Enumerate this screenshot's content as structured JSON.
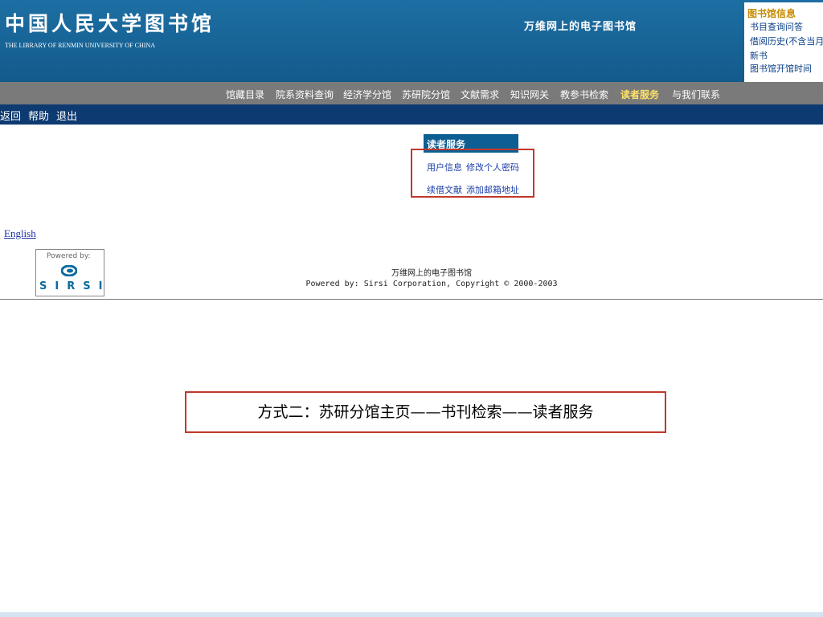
{
  "header": {
    "logo_cn": "中国人民大学图书馆",
    "logo_en": "THE LIBRARY OF RENMIN UNIVERSITY OF CHINA",
    "site_title": "万维网上的电子图书馆"
  },
  "info_box": {
    "title": "图书馆信息",
    "links": [
      "书目查询问答",
      "借阅历史(不含当月)",
      "新书",
      "图书馆开馆时间"
    ]
  },
  "nav": {
    "items": [
      "馆藏目录",
      "院系资料查询",
      "经济学分馆",
      "苏研院分馆",
      "文献需求",
      "知识网关",
      "教参书检索",
      "读者服务",
      "与我们联系"
    ],
    "active": "读者服务"
  },
  "subnav": {
    "items": [
      "返回",
      "帮助",
      "退出"
    ]
  },
  "reader_service": {
    "title": "读者服务",
    "links": [
      "用户信息",
      "修改个人密码",
      "续借文献",
      "添加邮箱地址"
    ]
  },
  "language_link": "English",
  "sirsi": {
    "powered_by": "Powered by:",
    "name": "SIRSI"
  },
  "footer": {
    "line1": "万维网上的电子图书馆",
    "line2": "Powered by: Sirsi Corporation, Copyright © 2000-2003"
  },
  "caption": "方式二：苏研分馆主页——书刊检索——读者服务",
  "colors": {
    "header_bg": "#1668a0",
    "nav_bg": "#7a7a7a",
    "subnav_bg": "#0d3a70",
    "active_nav": "#ffe26a",
    "highlight_border": "#c0392b"
  }
}
